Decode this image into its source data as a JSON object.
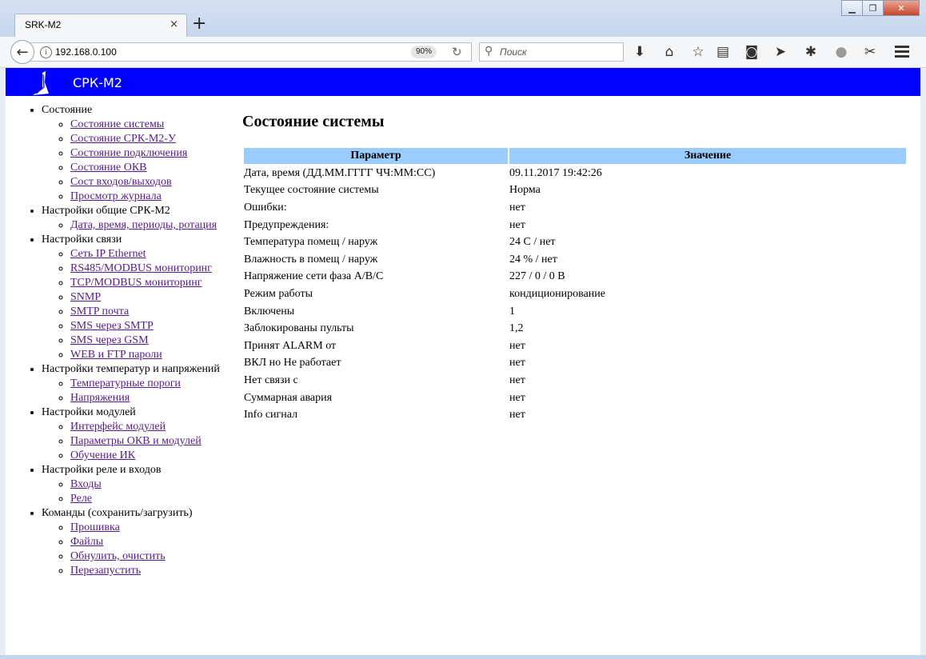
{
  "browser": {
    "tab_title": "SRK-M2",
    "tab_close": "×",
    "new_tab": "+",
    "url": "192.168.0.100",
    "zoom": "90%",
    "search_placeholder": "Поиск"
  },
  "site": {
    "brand": "СРК-М2",
    "brand_color": "#0000ff"
  },
  "sidebar": [
    {
      "label": "Состояние",
      "items": [
        "Состояние системы",
        "Состояние СРК-М2-У",
        "Состояние подключения",
        "Состояние ОКВ",
        "Сост входов/выходов",
        "Просмотр журнала"
      ]
    },
    {
      "label": "Настройки общие СРК-М2",
      "items": [
        "Дата, время, периоды, ротация"
      ]
    },
    {
      "label": "Настройки связи",
      "items": [
        "Сеть IP Ethernet",
        "RS485/MODBUS мониторинг",
        "TCP/MODBUS мониторинг",
        "SNMP",
        "SMTP почта",
        "SMS через SMTP",
        "SMS через GSM",
        "WEB и FTP пароли"
      ]
    },
    {
      "label": "Настройки температур и напряжений",
      "items": [
        "Температурные пороги",
        "Напряжения"
      ]
    },
    {
      "label": "Настройки модулей",
      "items": [
        "Интерфейс модулей",
        "Параметры ОКВ и модулей",
        "Обучение ИК"
      ]
    },
    {
      "label": "Настройки реле и входов",
      "items": [
        "Входы",
        "Реле"
      ]
    },
    {
      "label": "Команды (сохранить/загрузить)",
      "items": [
        "Прошивка",
        "Файлы",
        "Обнулить, очистить",
        "Перезапустить"
      ]
    }
  ],
  "main": {
    "title": "Состояние системы",
    "columns": [
      "Параметр",
      "Значение"
    ],
    "rows": [
      [
        "Дата, время (ДД.ММ.ГГГГ ЧЧ:ММ:СС)",
        "09.11.2017 19:42:26"
      ],
      [
        "Текущее состояние системы",
        "Норма"
      ],
      [
        "Ошибки:",
        "нет"
      ],
      [
        "Предупреждения:",
        "нет"
      ],
      [
        "Температура помещ / наруж",
        "24 С / нет"
      ],
      [
        "Влажность в помещ / наруж",
        "24 % / нет"
      ],
      [
        "Напряжение сети фаза A/B/C",
        "227 / 0 / 0 В"
      ],
      [
        "Режим работы",
        "кондиционирование"
      ],
      [
        "Включены",
        "1"
      ],
      [
        "Заблокированы пульты",
        "1,2"
      ],
      [
        "Принят ALARM от",
        "нет"
      ],
      [
        "ВКЛ но Не работает",
        "нет"
      ],
      [
        "Нет связи с",
        "нет"
      ],
      [
        "Суммарная авария",
        "нет"
      ],
      [
        "Info сигнал",
        "нет"
      ]
    ]
  }
}
